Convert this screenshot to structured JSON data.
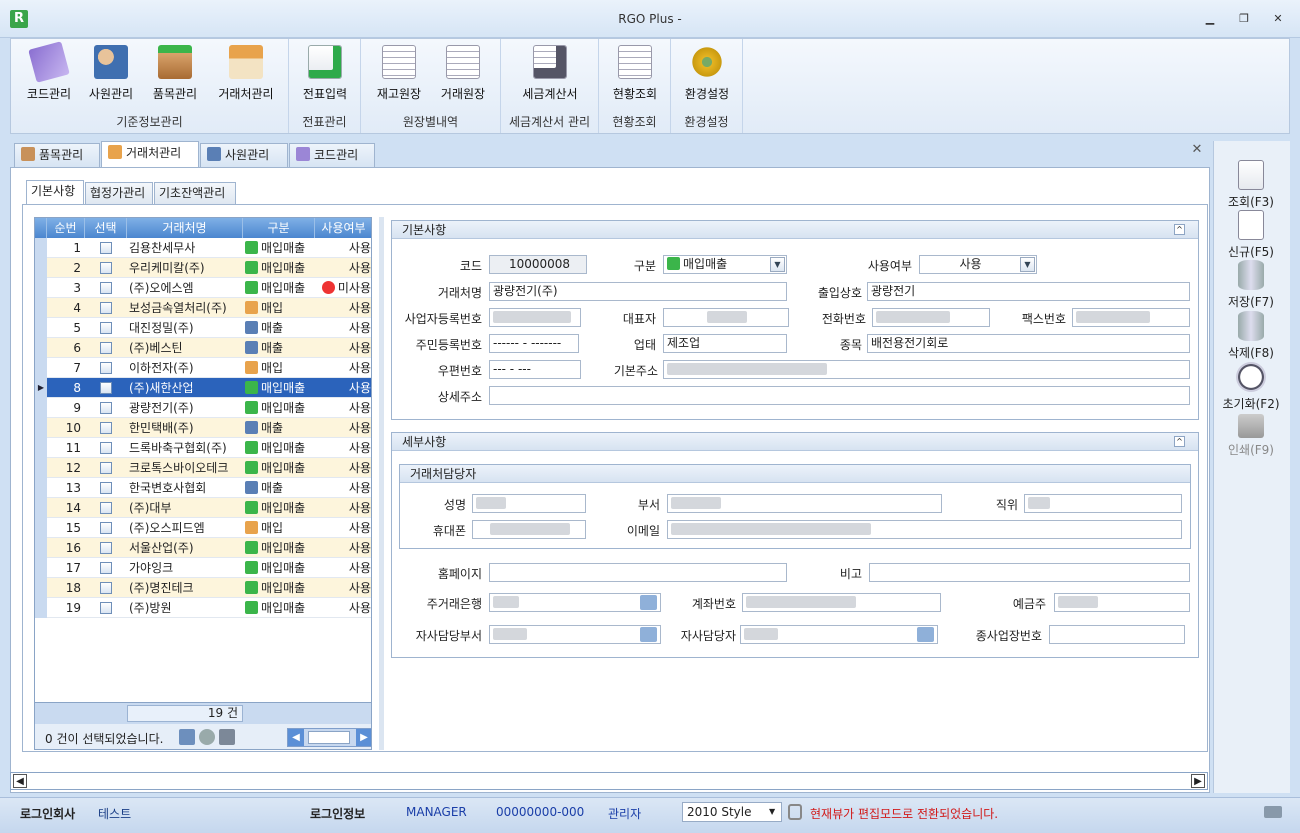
{
  "window": {
    "title": "RGO Plus -",
    "app_icon": "R"
  },
  "ribbon": {
    "groups": [
      {
        "label": "기준정보관리",
        "buttons": [
          "코드관리",
          "사원관리",
          "품목관리",
          "거래처관리"
        ]
      },
      {
        "label": "전표관리",
        "buttons": [
          "전표입력"
        ]
      },
      {
        "label": "원장별내역",
        "buttons": [
          "재고원장",
          "거래원장"
        ]
      },
      {
        "label": "세금계산서 관리",
        "buttons": [
          "세금계산서"
        ]
      },
      {
        "label": "현황조회",
        "buttons": [
          "현황조회"
        ]
      },
      {
        "label": "환경설정",
        "buttons": [
          "환경설정"
        ]
      }
    ]
  },
  "doc_tabs": [
    "품목관리",
    "거래처관리",
    "사원관리",
    "코드관리"
  ],
  "sub_tabs": [
    "기본사항",
    "협정가관리",
    "기초잔액관리"
  ],
  "grid": {
    "headers": [
      "순번",
      "선택",
      "거래처명",
      "구분",
      "사용여부"
    ],
    "rows": [
      {
        "no": "1",
        "name": "김용찬세무사",
        "type": "매입매출",
        "use": "사용"
      },
      {
        "no": "2",
        "name": "우리케미칼(주)",
        "type": "매입매출",
        "use": "사용"
      },
      {
        "no": "3",
        "name": "(주)오에스엠",
        "type": "매입매출",
        "use": "미사용"
      },
      {
        "no": "4",
        "name": "보성금속열처리(주)",
        "type": "매입",
        "use": "사용"
      },
      {
        "no": "5",
        "name": "대진정밀(주)",
        "type": "매출",
        "use": "사용"
      },
      {
        "no": "6",
        "name": "(주)베스틴",
        "type": "매출",
        "use": "사용"
      },
      {
        "no": "7",
        "name": "이하전자(주)",
        "type": "매입",
        "use": "사용"
      },
      {
        "no": "8",
        "name": "(주)새한산업",
        "type": "매입매출",
        "use": "사용"
      },
      {
        "no": "9",
        "name": "광량전기(주)",
        "type": "매입매출",
        "use": "사용"
      },
      {
        "no": "10",
        "name": "한민택배(주)",
        "type": "매출",
        "use": "사용"
      },
      {
        "no": "11",
        "name": "드록바축구협회(주)",
        "type": "매입매출",
        "use": "사용"
      },
      {
        "no": "12",
        "name": "크로톡스바이오테크",
        "type": "매입매출",
        "use": "사용"
      },
      {
        "no": "13",
        "name": "한국변호사협회",
        "type": "매출",
        "use": "사용"
      },
      {
        "no": "14",
        "name": "(주)대부",
        "type": "매입매출",
        "use": "사용"
      },
      {
        "no": "15",
        "name": "(주)오스피드엠",
        "type": "매입",
        "use": "사용"
      },
      {
        "no": "16",
        "name": "서울산업(주)",
        "type": "매입매출",
        "use": "사용"
      },
      {
        "no": "17",
        "name": "가야잉크",
        "type": "매입매출",
        "use": "사용"
      },
      {
        "no": "18",
        "name": "(주)명진테크",
        "type": "매입매출",
        "use": "사용"
      },
      {
        "no": "19",
        "name": "(주)방원",
        "type": "매입매출",
        "use": "사용"
      }
    ],
    "total": "19 건",
    "selected_status": "0 건이 선택되었습니다."
  },
  "basic": {
    "title": "기본사항",
    "code_label": "코드",
    "code": "10000008",
    "type_label": "구분",
    "type": "매입매출",
    "use_label": "사용여부",
    "use": "사용",
    "name_label": "거래처명",
    "name": "광량전기(주)",
    "out_name_label": "출입상호",
    "out_name": "광량전기",
    "bizno_label": "사업자등록번호",
    "ceo_label": "대표자",
    "phone_label": "전화번호",
    "fax_label": "팩스번호",
    "resid_label": "주민등록번호",
    "resid": "------ - -------",
    "biztype_label": "업태",
    "biztype": "제조업",
    "bizitem_label": "종목",
    "bizitem": "배전용전기회로",
    "zip_label": "우편번호",
    "zip": "--- - ---",
    "addr_label": "기본주소",
    "detail_label": "상세주소"
  },
  "detail": {
    "title": "세부사항",
    "contact_title": "거래처담당자",
    "person_label": "성명",
    "dept_label": "부서",
    "position_label": "직위",
    "mobile_label": "휴대폰",
    "email_label": "이메일",
    "homepage_label": "홈페이지",
    "note_label": "비고",
    "bank_label": "주거래은행",
    "account_label": "계좌번호",
    "holder_label": "예금주",
    "our_dept_label": "자사담당부서",
    "our_person_label": "자사담당자",
    "branch_label": "종사업장번호"
  },
  "side_buttons": [
    "조회(F3)",
    "신규(F5)",
    "저장(F7)",
    "삭제(F8)",
    "초기화(F2)",
    "인쇄(F9)"
  ],
  "status": {
    "company_label": "로그인회사",
    "company": "테스트",
    "info_label": "로그인정보",
    "user": "MANAGER",
    "user_code": "00000000-000",
    "role": "관리자",
    "style": "2010 Style",
    "message": "현재뷰가 편집모드로 전환되었습니다."
  },
  "colors": {
    "accent": "#2b63bb",
    "warning": "#d11a1a",
    "header_blue": "#4b86cf"
  }
}
